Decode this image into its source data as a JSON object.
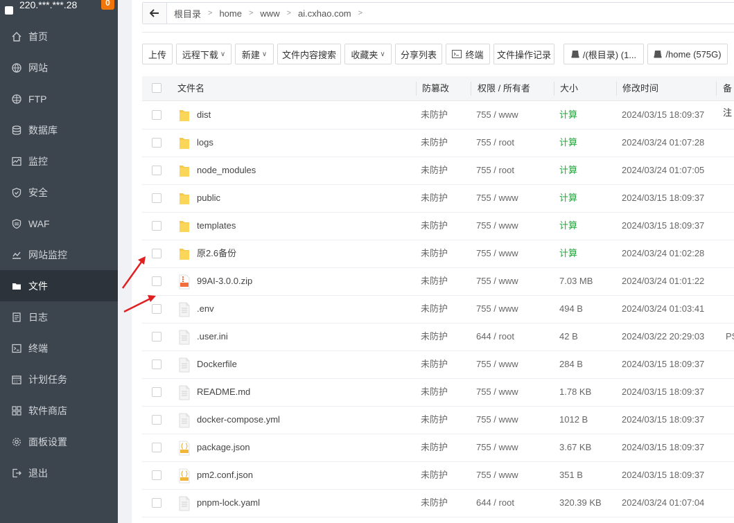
{
  "server": {
    "ip": "220.***.***.28",
    "badge": "0"
  },
  "nav": [
    {
      "label": "首页",
      "icon": "home-icon",
      "active": false
    },
    {
      "label": "网站",
      "icon": "globe-icon",
      "active": false
    },
    {
      "label": "FTP",
      "icon": "ftp-icon",
      "active": false
    },
    {
      "label": "数据库",
      "icon": "database-icon",
      "active": false
    },
    {
      "label": "监控",
      "icon": "monitor-icon",
      "active": false
    },
    {
      "label": "安全",
      "icon": "shield-icon",
      "active": false
    },
    {
      "label": "WAF",
      "icon": "waf-icon",
      "active": false
    },
    {
      "label": "网站监控",
      "icon": "chart-icon",
      "active": false
    },
    {
      "label": "文件",
      "icon": "folder-icon",
      "active": true
    },
    {
      "label": "日志",
      "icon": "log-icon",
      "active": false
    },
    {
      "label": "终端",
      "icon": "terminal-icon",
      "active": false
    },
    {
      "label": "计划任务",
      "icon": "calendar-icon",
      "active": false
    },
    {
      "label": "软件商店",
      "icon": "grid-icon",
      "active": false
    },
    {
      "label": "面板设置",
      "icon": "gear-icon",
      "active": false
    },
    {
      "label": "退出",
      "icon": "logout-icon",
      "active": false
    }
  ],
  "path": [
    "根目录",
    "home",
    "www",
    "ai.cxhao.com"
  ],
  "toolbar": {
    "upload": "上传",
    "remote_download": "远程下载",
    "new": "新建",
    "content_search": "文件内容搜索",
    "favorites": "收藏夹",
    "share_list": "分享列表",
    "terminal": "终端",
    "op_log": "文件操作记录",
    "disk_root": "/(根目录) (1...",
    "disk_home": "/home (575G)"
  },
  "table": {
    "headers": {
      "name": "文件名",
      "tamper": "防篡改",
      "perm": "权限 / 所有者",
      "size": "大小",
      "mtime": "修改时间",
      "remark": "备注"
    },
    "rows": [
      {
        "name": "dist",
        "type": "folder",
        "tamper": "未防护",
        "perm": "755 / www",
        "size": "计算",
        "mtime": "2024/03/15 18:09:37",
        "remark": ""
      },
      {
        "name": "logs",
        "type": "folder",
        "tamper": "未防护",
        "perm": "755 / root",
        "size": "计算",
        "mtime": "2024/03/24 01:07:28",
        "remark": ""
      },
      {
        "name": "node_modules",
        "type": "folder",
        "tamper": "未防护",
        "perm": "755 / root",
        "size": "计算",
        "mtime": "2024/03/24 01:07:05",
        "remark": ""
      },
      {
        "name": "public",
        "type": "folder",
        "tamper": "未防护",
        "perm": "755 / www",
        "size": "计算",
        "mtime": "2024/03/15 18:09:37",
        "remark": ""
      },
      {
        "name": "templates",
        "type": "folder",
        "tamper": "未防护",
        "perm": "755 / www",
        "size": "计算",
        "mtime": "2024/03/15 18:09:37",
        "remark": ""
      },
      {
        "name": "原2.6备份",
        "type": "folder",
        "tamper": "未防护",
        "perm": "755 / www",
        "size": "计算",
        "mtime": "2024/03/24 01:02:28",
        "remark": ""
      },
      {
        "name": "99AI-3.0.0.zip",
        "type": "zip",
        "tamper": "未防护",
        "perm": "755 / www",
        "size": "7.03 MB",
        "mtime": "2024/03/24 01:01:22",
        "remark": ""
      },
      {
        "name": ".env",
        "type": "file",
        "tamper": "未防护",
        "perm": "755 / www",
        "size": "494 B",
        "mtime": "2024/03/24 01:03:41",
        "remark": ""
      },
      {
        "name": ".user.ini",
        "type": "file",
        "tamper": "未防护",
        "perm": "644 / root",
        "size": "42 B",
        "mtime": "2024/03/22 20:29:03",
        "remark": "PS"
      },
      {
        "name": "Dockerfile",
        "type": "file",
        "tamper": "未防护",
        "perm": "755 / www",
        "size": "284 B",
        "mtime": "2024/03/15 18:09:37",
        "remark": ""
      },
      {
        "name": "README.md",
        "type": "file",
        "tamper": "未防护",
        "perm": "755 / www",
        "size": "1.78 KB",
        "mtime": "2024/03/15 18:09:37",
        "remark": ""
      },
      {
        "name": "docker-compose.yml",
        "type": "file",
        "tamper": "未防护",
        "perm": "755 / www",
        "size": "1012 B",
        "mtime": "2024/03/15 18:09:37",
        "remark": ""
      },
      {
        "name": "package.json",
        "type": "json",
        "tamper": "未防护",
        "perm": "755 / www",
        "size": "3.67 KB",
        "mtime": "2024/03/15 18:09:37",
        "remark": ""
      },
      {
        "name": "pm2.conf.json",
        "type": "json",
        "tamper": "未防护",
        "perm": "755 / www",
        "size": "351 B",
        "mtime": "2024/03/15 18:09:37",
        "remark": ""
      },
      {
        "name": "pnpm-lock.yaml",
        "type": "file",
        "tamper": "未防护",
        "perm": "644 / root",
        "size": "320.39 KB",
        "mtime": "2024/03/24 01:07:04",
        "remark": ""
      }
    ]
  },
  "colors": {
    "sidebar": "#3c444d",
    "sidebar_active": "#2d333a",
    "badge": "#f0750b",
    "calc_green": "#20a53a",
    "folder": "#f7c948",
    "arrow": "#e02020"
  }
}
